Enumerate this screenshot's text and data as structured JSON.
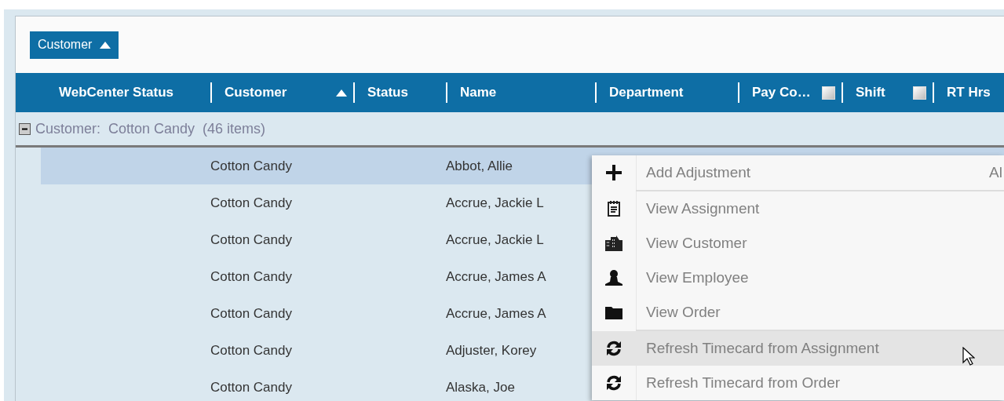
{
  "group_panel": {
    "chips": [
      {
        "label": "Customer",
        "sorted": true
      }
    ]
  },
  "columns": [
    {
      "label": "WebCenter Status",
      "sorted": false,
      "filter": false
    },
    {
      "label": "Customer",
      "sorted": true,
      "filter": false
    },
    {
      "label": "Status",
      "sorted": false,
      "filter": false
    },
    {
      "label": "Name",
      "sorted": false,
      "filter": false
    },
    {
      "label": "Department",
      "sorted": false,
      "filter": false
    },
    {
      "label": "Pay Co…",
      "sorted": false,
      "filter": true
    },
    {
      "label": "Shift",
      "sorted": false,
      "filter": true
    },
    {
      "label": "RT Hrs",
      "sorted": false,
      "filter": false
    }
  ],
  "group": {
    "label": "Customer:  Cotton Candy  (46 items)",
    "expanded": true
  },
  "rows": [
    {
      "customer": "Cotton Candy",
      "name": "Abbot, Allie",
      "selected": true
    },
    {
      "customer": "Cotton Candy",
      "name": "Accrue, Jackie L",
      "selected": false
    },
    {
      "customer": "Cotton Candy",
      "name": "Accrue, Jackie L",
      "selected": false
    },
    {
      "customer": "Cotton Candy",
      "name": "Accrue, James A",
      "selected": false
    },
    {
      "customer": "Cotton Candy",
      "name": "Accrue, James A",
      "selected": false
    },
    {
      "customer": "Cotton Candy",
      "name": "Adjuster, Korey",
      "selected": false
    },
    {
      "customer": "Cotton Candy",
      "name": "Alaska, Joe",
      "selected": false
    }
  ],
  "context_menu": {
    "groups": [
      [
        {
          "label": "Add Adjustment",
          "shortcut": "Al",
          "selected": false
        }
      ],
      [
        {
          "label": "View Assignment",
          "selected": false
        },
        {
          "label": "View Customer",
          "selected": false
        },
        {
          "label": "View Employee",
          "selected": false
        },
        {
          "label": "View Order",
          "selected": false
        }
      ],
      [
        {
          "label": "Refresh Timecard from Assignment",
          "selected": true
        },
        {
          "label": "Refresh Timecard from Order",
          "selected": false
        }
      ]
    ]
  }
}
